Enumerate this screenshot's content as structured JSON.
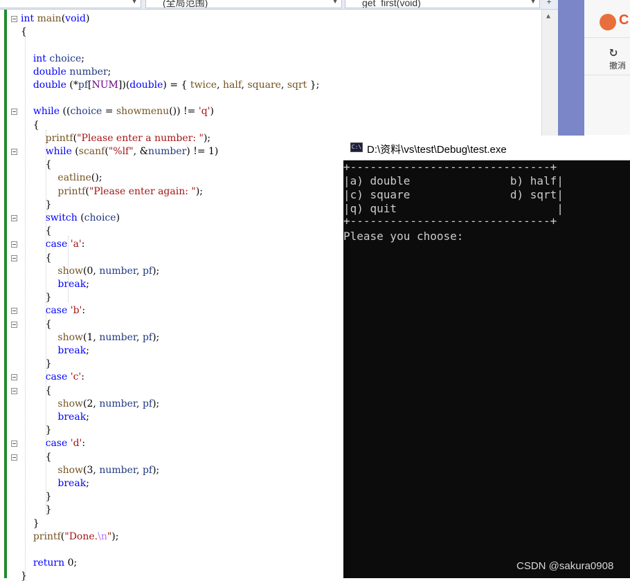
{
  "toolbar": {
    "scope_combo": "(全局范围)",
    "member_combo": "get_first(void)",
    "pin_symbol": "+"
  },
  "code_lines": [
    [
      {
        "t": "int",
        "c": "kw"
      },
      {
        "t": " "
      },
      {
        "t": "main",
        "c": "fn"
      },
      {
        "t": "("
      },
      {
        "t": "void",
        "c": "kw"
      },
      {
        "t": ")"
      }
    ],
    [
      {
        "t": "{"
      }
    ],
    [],
    [
      {
        "t": "    "
      },
      {
        "t": "int",
        "c": "kw"
      },
      {
        "t": " "
      },
      {
        "t": "choice",
        "c": "var"
      },
      {
        "t": ";"
      }
    ],
    [
      {
        "t": "    "
      },
      {
        "t": "double",
        "c": "kw"
      },
      {
        "t": " "
      },
      {
        "t": "number",
        "c": "var"
      },
      {
        "t": ";"
      }
    ],
    [
      {
        "t": "    "
      },
      {
        "t": "double",
        "c": "kw"
      },
      {
        "t": " (*"
      },
      {
        "t": "pf",
        "c": "var"
      },
      {
        "t": "["
      },
      {
        "t": "NUM",
        "c": "mac"
      },
      {
        "t": "])("
      },
      {
        "t": "double",
        "c": "kw"
      },
      {
        "t": ") = { "
      },
      {
        "t": "twice",
        "c": "fn"
      },
      {
        "t": ", "
      },
      {
        "t": "half",
        "c": "fn"
      },
      {
        "t": ", "
      },
      {
        "t": "square",
        "c": "fn"
      },
      {
        "t": ", "
      },
      {
        "t": "sqrt",
        "c": "fn"
      },
      {
        "t": " };"
      }
    ],
    [],
    [
      {
        "t": "    "
      },
      {
        "t": "while",
        "c": "kw"
      },
      {
        "t": " (("
      },
      {
        "t": "choice",
        "c": "var"
      },
      {
        "t": " = "
      },
      {
        "t": "showmenu",
        "c": "fn"
      },
      {
        "t": "()) != "
      },
      {
        "t": "'q'",
        "c": "str"
      },
      {
        "t": ")"
      }
    ],
    [
      {
        "t": "    {"
      }
    ],
    [
      {
        "t": "        "
      },
      {
        "t": "printf",
        "c": "fn"
      },
      {
        "t": "("
      },
      {
        "t": "\"Please enter a number: \"",
        "c": "str"
      },
      {
        "t": ");"
      }
    ],
    [
      {
        "t": "        "
      },
      {
        "t": "while",
        "c": "kw"
      },
      {
        "t": " ("
      },
      {
        "t": "scanf",
        "c": "fn"
      },
      {
        "t": "("
      },
      {
        "t": "\"%lf\"",
        "c": "str"
      },
      {
        "t": ", &"
      },
      {
        "t": "number",
        "c": "var"
      },
      {
        "t": ") != 1)"
      }
    ],
    [
      {
        "t": "        {"
      }
    ],
    [
      {
        "t": "            "
      },
      {
        "t": "eatline",
        "c": "fn"
      },
      {
        "t": "();"
      }
    ],
    [
      {
        "t": "            "
      },
      {
        "t": "printf",
        "c": "fn"
      },
      {
        "t": "("
      },
      {
        "t": "\"Please enter again: \"",
        "c": "str"
      },
      {
        "t": ");"
      }
    ],
    [
      {
        "t": "        }"
      }
    ],
    [
      {
        "t": "        "
      },
      {
        "t": "switch",
        "c": "kw"
      },
      {
        "t": " ("
      },
      {
        "t": "choice",
        "c": "var"
      },
      {
        "t": ")"
      }
    ],
    [
      {
        "t": "        {"
      }
    ],
    [
      {
        "t": "        "
      },
      {
        "t": "case",
        "c": "kw"
      },
      {
        "t": " "
      },
      {
        "t": "'a'",
        "c": "str"
      },
      {
        "t": ":"
      }
    ],
    [
      {
        "t": "        {"
      }
    ],
    [
      {
        "t": "            "
      },
      {
        "t": "show",
        "c": "fn"
      },
      {
        "t": "(0, "
      },
      {
        "t": "number",
        "c": "var"
      },
      {
        "t": ", "
      },
      {
        "t": "pf",
        "c": "var"
      },
      {
        "t": ");"
      }
    ],
    [
      {
        "t": "            "
      },
      {
        "t": "break",
        "c": "kw"
      },
      {
        "t": ";"
      }
    ],
    [
      {
        "t": "        }"
      }
    ],
    [
      {
        "t": "        "
      },
      {
        "t": "case",
        "c": "kw"
      },
      {
        "t": " "
      },
      {
        "t": "'b'",
        "c": "str"
      },
      {
        "t": ":"
      }
    ],
    [
      {
        "t": "        {"
      }
    ],
    [
      {
        "t": "            "
      },
      {
        "t": "show",
        "c": "fn"
      },
      {
        "t": "(1, "
      },
      {
        "t": "number",
        "c": "var"
      },
      {
        "t": ", "
      },
      {
        "t": "pf",
        "c": "var"
      },
      {
        "t": ");"
      }
    ],
    [
      {
        "t": "            "
      },
      {
        "t": "break",
        "c": "kw"
      },
      {
        "t": ";"
      }
    ],
    [
      {
        "t": "        }"
      }
    ],
    [
      {
        "t": "        "
      },
      {
        "t": "case",
        "c": "kw"
      },
      {
        "t": " "
      },
      {
        "t": "'c'",
        "c": "str"
      },
      {
        "t": ":"
      }
    ],
    [
      {
        "t": "        {"
      }
    ],
    [
      {
        "t": "            "
      },
      {
        "t": "show",
        "c": "fn"
      },
      {
        "t": "(2, "
      },
      {
        "t": "number",
        "c": "var"
      },
      {
        "t": ", "
      },
      {
        "t": "pf",
        "c": "var"
      },
      {
        "t": ");"
      }
    ],
    [
      {
        "t": "            "
      },
      {
        "t": "break",
        "c": "kw"
      },
      {
        "t": ";"
      }
    ],
    [
      {
        "t": "        }"
      }
    ],
    [
      {
        "t": "        "
      },
      {
        "t": "case",
        "c": "kw"
      },
      {
        "t": " "
      },
      {
        "t": "'d'",
        "c": "str"
      },
      {
        "t": ":"
      }
    ],
    [
      {
        "t": "        {"
      }
    ],
    [
      {
        "t": "            "
      },
      {
        "t": "show",
        "c": "fn"
      },
      {
        "t": "(3, "
      },
      {
        "t": "number",
        "c": "var"
      },
      {
        "t": ", "
      },
      {
        "t": "pf",
        "c": "var"
      },
      {
        "t": ");"
      }
    ],
    [
      {
        "t": "            "
      },
      {
        "t": "break",
        "c": "kw"
      },
      {
        "t": ";"
      }
    ],
    [
      {
        "t": "        }"
      }
    ],
    [
      {
        "t": "        }"
      }
    ],
    [
      {
        "t": "    }"
      }
    ],
    [
      {
        "t": "    "
      },
      {
        "t": "printf",
        "c": "fn"
      },
      {
        "t": "("
      },
      {
        "t": "\"Done.",
        "c": "str"
      },
      {
        "t": "\\n",
        "c": "esc"
      },
      {
        "t": "\"",
        "c": "str"
      },
      {
        "t": ");"
      }
    ],
    [],
    [
      {
        "t": "    "
      },
      {
        "t": "return",
        "c": "kw"
      },
      {
        "t": " 0;"
      }
    ],
    [
      {
        "t": "}"
      }
    ]
  ],
  "fold_markers": [
    "⊟",
    "⊟",
    "⊟",
    "⊟",
    "⊟",
    "⊟",
    "⊟",
    "⊟",
    "⊟",
    "⊟",
    "⊟",
    "⊟"
  ],
  "console": {
    "title": "D:\\资料\\vs\\test\\Debug\\test.exe",
    "icon_text": "C:\\",
    "lines": [
      "+------------------------------+",
      "|a) double               b) half|",
      "|c) square               d) sqrt|",
      "|q) quit                        |",
      "+------------------------------+",
      "Please you choose:"
    ]
  },
  "right_panel": {
    "logo_text": "C",
    "undo_label": "撤消",
    "undo_symbol": "↻"
  },
  "watermark": "CSDN @sakura0908",
  "colors": {
    "keyword": "#0000ff",
    "function": "#74531f",
    "string": "#a31515",
    "macro": "#6f008a",
    "console_bg": "#0c0c0c",
    "change_bar": "#1f8a2b"
  }
}
